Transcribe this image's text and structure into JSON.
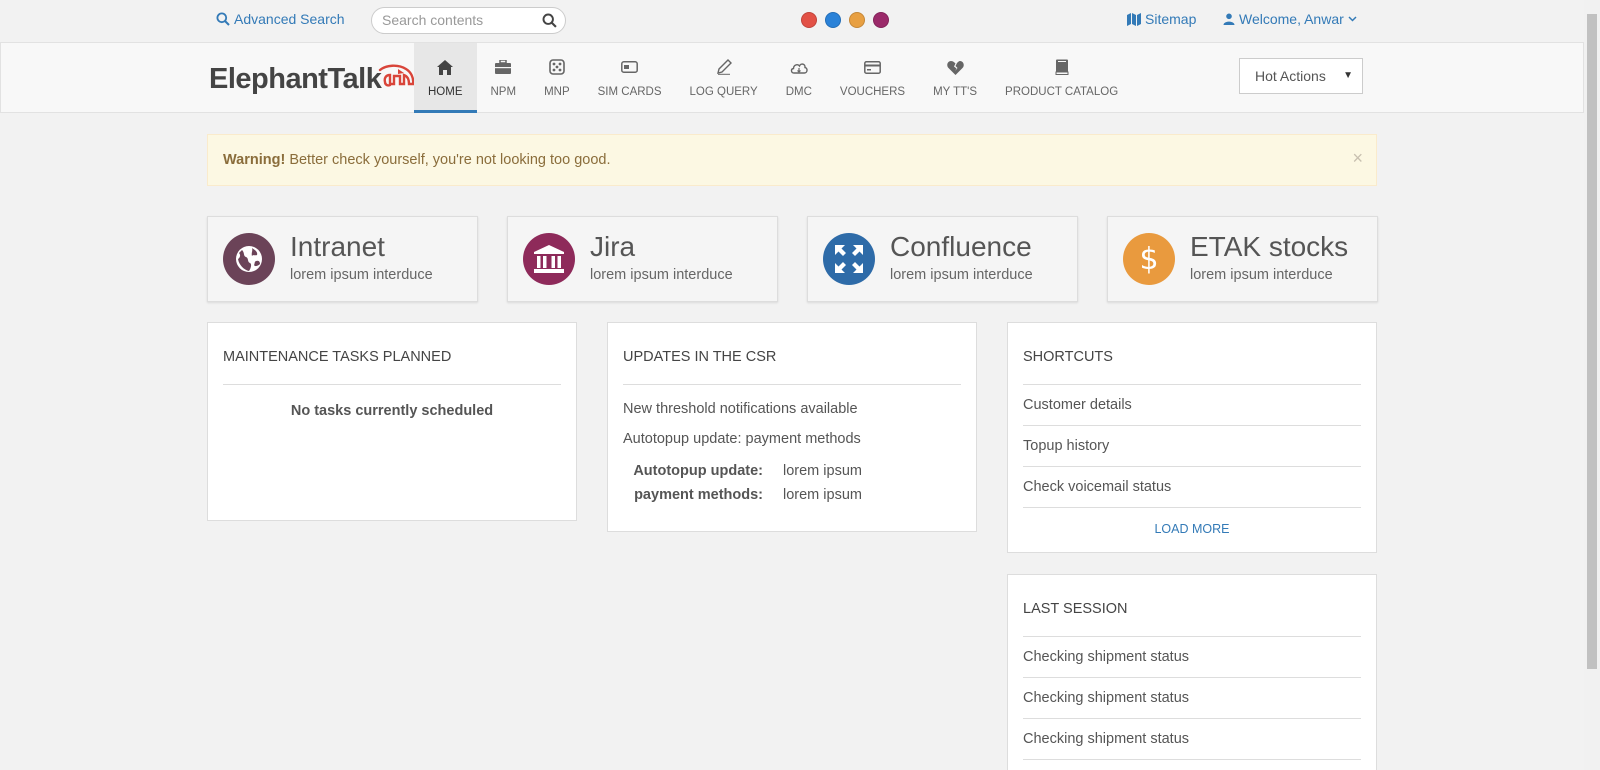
{
  "topbar": {
    "advanced_search": "Advanced Search",
    "search_placeholder": "Search contents",
    "dots": [
      "#e25146",
      "#2a82d8",
      "#e8a042",
      "#9b2a6a"
    ],
    "sitemap": "Sitemap",
    "welcome": "Welcome, Anwar"
  },
  "navbar": {
    "logo": "ElephantTalk",
    "items": [
      {
        "label": "HOME",
        "icon": "home-icon",
        "active": true
      },
      {
        "label": "NPM",
        "icon": "briefcase-icon"
      },
      {
        "label": "MNP",
        "icon": "dice-icon"
      },
      {
        "label": "SIM CARDS",
        "icon": "sim-card-icon"
      },
      {
        "label": "LOG QUERY",
        "icon": "pencil-icon"
      },
      {
        "label": "DMC",
        "icon": "cloud-icon"
      },
      {
        "label": "VOUCHERS",
        "icon": "credit-card-icon"
      },
      {
        "label": "MY TT'S",
        "icon": "broken-heart-icon"
      },
      {
        "label": "PRODUCT CATALOG",
        "icon": "book-icon"
      }
    ],
    "hot_actions": "Hot Actions"
  },
  "alert": {
    "strong": "Warning!",
    "text": " Better check yourself, you're not looking too good.",
    "close": "×"
  },
  "tiles": [
    {
      "title": "Intranet",
      "subtitle": "lorem ipsum interduce",
      "color": "#6b4358",
      "icon": "globe-icon"
    },
    {
      "title": "Jira",
      "subtitle": "lorem ipsum interduce",
      "color": "#8e2a5a",
      "icon": "bank-icon"
    },
    {
      "title": "Confluence",
      "subtitle": "lorem ipsum interduce",
      "color": "#2e6ba8",
      "icon": "expand-icon"
    },
    {
      "title": "ETAK stocks",
      "subtitle": "lorem ipsum interduce",
      "color": "#e99a3e",
      "icon": "dollar-icon"
    }
  ],
  "maintenance": {
    "title": "MAINTENANCE TASKS PLANNED",
    "empty": "No tasks currently scheduled"
  },
  "updates": {
    "title": "UPDATES IN THE CSR",
    "lines": [
      "New threshold notifications available",
      "Autotopup update: payment methods"
    ],
    "rows": [
      {
        "key": "Autotopup update:",
        "value": "lorem ipsum"
      },
      {
        "key": "payment methods:",
        "value": "lorem ipsum"
      }
    ]
  },
  "shortcuts": {
    "title": "SHORTCUTS",
    "items": [
      "Customer details",
      "Topup history",
      "Check voicemail status"
    ],
    "load_more": "LOAD MORE"
  },
  "last_session": {
    "title": "LAST SESSION",
    "items": [
      "Checking shipment status",
      "Checking shipment status",
      "Checking shipment status"
    ]
  }
}
